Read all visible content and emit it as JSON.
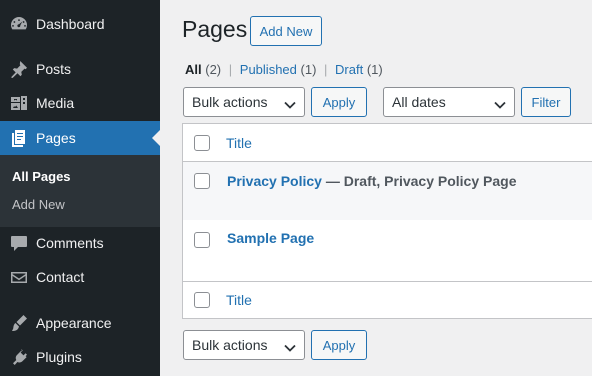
{
  "sidebar": {
    "items": [
      {
        "label": "Dashboard",
        "icon": "dashboard-icon"
      },
      {
        "label": "Posts",
        "icon": "pin-icon"
      },
      {
        "label": "Media",
        "icon": "media-icon"
      },
      {
        "label": "Pages",
        "icon": "pages-icon"
      },
      {
        "label": "Comments",
        "icon": "comment-icon"
      },
      {
        "label": "Contact",
        "icon": "envelope-icon"
      },
      {
        "label": "Appearance",
        "icon": "brush-icon"
      },
      {
        "label": "Plugins",
        "icon": "plugin-icon"
      }
    ],
    "submenu": [
      "All Pages",
      "Add New"
    ]
  },
  "header": {
    "title": "Pages",
    "add_new": "Add New"
  },
  "filters": {
    "all": "All",
    "all_count": "(2)",
    "published": "Published",
    "published_count": "(1)",
    "draft": "Draft",
    "draft_count": "(1)",
    "separator": "|"
  },
  "toolbar": {
    "bulk_actions": "Bulk actions",
    "apply": "Apply",
    "all_dates": "All dates",
    "filter": "Filter"
  },
  "table": {
    "column_title": "Title",
    "rows": [
      {
        "title": "Privacy Policy",
        "state": " — Draft, Privacy Policy Page"
      },
      {
        "title": "Sample Page",
        "state": ""
      }
    ]
  },
  "colors": {
    "accent": "#2271b1",
    "sidebar_bg": "#1d2327",
    "page_bg": "#f0f0f1"
  }
}
